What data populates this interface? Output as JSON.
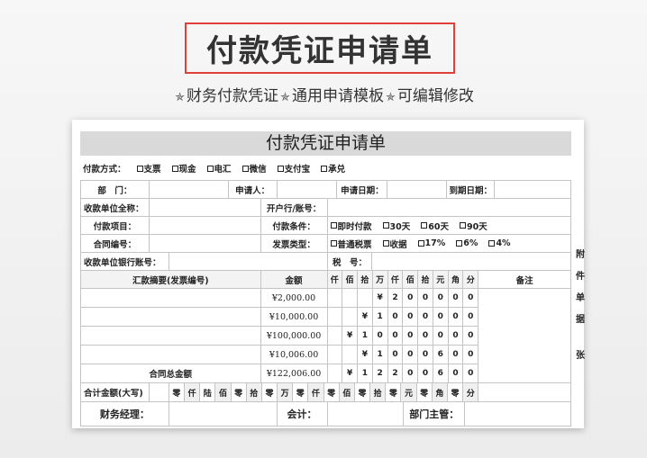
{
  "header": {
    "title": "付款凭证申请单",
    "subtitle_parts": [
      "财务付款凭证",
      "通用申请模板",
      "可编辑修改"
    ],
    "star_icon": "✯"
  },
  "form": {
    "title": "付款凭证申请单",
    "payment_method_label": "付款方式：",
    "payment_methods": [
      "支票",
      "现金",
      "电汇",
      "微信",
      "支付宝",
      "承兑"
    ],
    "fields": {
      "dept": "部　门：",
      "applicant": "申请人：",
      "apply_date": "申请日期：",
      "due_date": "到期日期：",
      "payee": "收款单位全称：",
      "bank": "开户行/账号：",
      "item": "付款项目：",
      "terms": "付款条件：",
      "contract": "合同编号：",
      "invoice_type": "发票类型：",
      "payee_account": "收款单位银行账号：",
      "tax_no": "税　号："
    },
    "terms_options": [
      "即时付款",
      "30天",
      "60天",
      "90天"
    ],
    "invoice_options": [
      "普通税票",
      "收据",
      "17%",
      "6%",
      "4%"
    ],
    "amount_table": {
      "headers": {
        "summary": "汇款摘要(发票编号)",
        "amount": "金额",
        "digits": [
          "仟",
          "佰",
          "拾",
          "万",
          "仟",
          "佰",
          "拾",
          "元",
          "角",
          "分"
        ],
        "remark": "备注"
      },
      "rows": [
        {
          "amount": "¥2,000.00",
          "digits": [
            "",
            "",
            "",
            "¥",
            "2",
            "0",
            "0",
            "0",
            "0",
            "0"
          ]
        },
        {
          "amount": "¥10,000.00",
          "digits": [
            "",
            "",
            "¥",
            "1",
            "0",
            "0",
            "0",
            "0",
            "0",
            "0"
          ]
        },
        {
          "amount": "¥100,000.00",
          "digits": [
            "",
            "¥",
            "1",
            "0",
            "0",
            "0",
            "0",
            "0",
            "0",
            "0"
          ]
        },
        {
          "amount": "¥10,006.00",
          "digits": [
            "",
            "",
            "¥",
            "1",
            "0",
            "0",
            "0",
            "6",
            "0",
            "0"
          ]
        }
      ],
      "total_label": "合同总金额",
      "total": {
        "amount": "¥122,006.00",
        "digits": [
          "",
          "¥",
          "1",
          "2",
          "2",
          "0",
          "0",
          "6",
          "0",
          "0"
        ]
      }
    },
    "capital": {
      "label": "合计金额(大写)",
      "cells": [
        "零",
        "仟",
        "陆",
        "佰",
        "零",
        "拾",
        "零",
        "万",
        "零",
        "仟",
        "零",
        "佰",
        "零",
        "拾",
        "零",
        "元",
        "零",
        "角",
        "零",
        "分"
      ]
    },
    "signatures": {
      "finance_manager": "财务经理：",
      "accountant": "会计：",
      "dept_head": "部门主管："
    },
    "side_label": [
      "附",
      "件",
      "单",
      "据",
      "张"
    ]
  }
}
